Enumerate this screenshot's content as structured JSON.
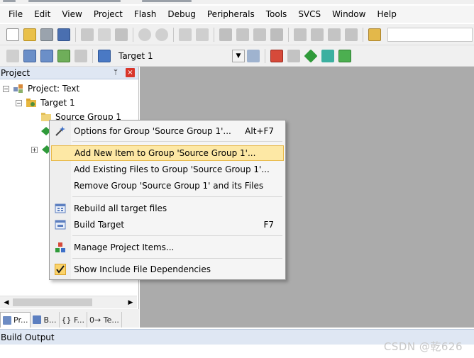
{
  "menubar": [
    "File",
    "Edit",
    "View",
    "Project",
    "Flash",
    "Debug",
    "Peripherals",
    "Tools",
    "SVCS",
    "Window",
    "Help"
  ],
  "toolbar2": {
    "target": "Target 1"
  },
  "project_pane": {
    "title": "Project",
    "tree": {
      "project": "Project: Text",
      "target": "Target 1",
      "group": "Source Group 1"
    },
    "tabs": [
      "Pr...",
      "B...",
      "{} F...",
      "0→ Te..."
    ]
  },
  "context_menu": {
    "items": [
      {
        "label": "Options for Group 'Source Group 1'...",
        "shortcut": "Alt+F7",
        "icon": "options-wand-icon"
      },
      {
        "label": "Add New  Item to Group 'Source Group 1'...",
        "shortcut": "",
        "icon": "",
        "highlighted": true
      },
      {
        "label": "Add Existing Files to Group 'Source Group 1'...",
        "shortcut": "",
        "icon": ""
      },
      {
        "label": "Remove Group 'Source Group 1' and its Files",
        "shortcut": "",
        "icon": ""
      },
      {
        "label": "Rebuild all target files",
        "shortcut": "",
        "icon": "rebuild-icon"
      },
      {
        "label": "Build Target",
        "shortcut": "F7",
        "icon": "build-icon"
      },
      {
        "label": "Manage Project Items...",
        "shortcut": "",
        "icon": "manage-items-icon"
      },
      {
        "label": "Show Include File Dependencies",
        "shortcut": "",
        "icon": "checkmark-icon"
      }
    ]
  },
  "build_output": {
    "title": "Build Output"
  },
  "watermark": "CSDN @乾626",
  "colors": {
    "pane_header": "#dfe7f3",
    "editor_background": "#ababab",
    "menu_highlight": "#fde8a5",
    "menu_highlight_border": "#e8b94a"
  }
}
